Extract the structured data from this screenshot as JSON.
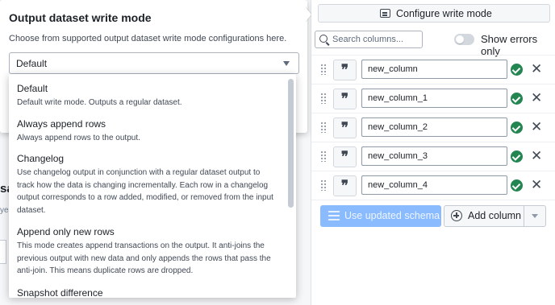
{
  "popover": {
    "title": "Output dataset write mode",
    "description": "Choose from supported output dataset write mode configurations here.",
    "select": {
      "value": "Default"
    },
    "options": [
      {
        "title": "Default",
        "description": "Default write mode. Outputs a regular dataset."
      },
      {
        "title": "Always append rows",
        "description": "Always append rows to the output."
      },
      {
        "title": "Changelog",
        "description": "Use changelog output in conjunction with a regular dataset output to track how the data is changing incrementally. Each row in a changelog output corresponds to a row added, modified, or removed from the input dataset."
      },
      {
        "title": "Append only new rows",
        "description": "This mode creates append transactions on the output. It anti-joins the previous output with new data and only appends the rows that pass the anti-join. This means duplicate rows are dropped."
      },
      {
        "title": "Snapshot difference",
        "description": ""
      }
    ]
  },
  "background": {
    "frag_sa": "sa",
    "frag_ye": "ye"
  },
  "panel": {
    "configure_label": "Configure write mode",
    "search_placeholder": "Search columns...",
    "show_errors_label": "Show errors only",
    "show_errors_on": false,
    "columns": [
      {
        "name": "new_column",
        "type_icon": "string-type-icon",
        "valid": true
      },
      {
        "name": "new_column_1",
        "type_icon": "string-type-icon",
        "valid": true
      },
      {
        "name": "new_column_2",
        "type_icon": "string-type-icon",
        "valid": true
      },
      {
        "name": "new_column_3",
        "type_icon": "string-type-icon",
        "valid": true
      },
      {
        "name": "new_column_4",
        "type_icon": "string-type-icon",
        "valid": true
      }
    ],
    "use_schema_label": "Use updated schema",
    "add_column_label": "Add column"
  },
  "colors": {
    "primary_disabled": "#8abbff",
    "success": "#238551"
  }
}
